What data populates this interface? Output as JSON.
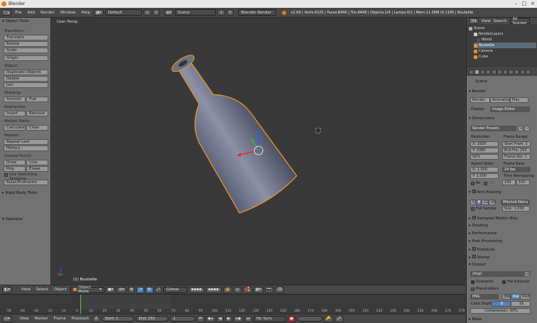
{
  "window": {
    "title": "Blender"
  },
  "topbar": {
    "menus": [
      "File",
      "Add",
      "Render",
      "Window",
      "Help"
    ],
    "layout": "Default",
    "scene": "Scene",
    "engine": "Blender Render",
    "stats": "v2.69 | Verts:4225 | Faces:8440 | Tris:8448 | Objects:1/4 | Lamps:0/2 | Mem:11.00M (0.11M) | Bouteille"
  },
  "toolshelf": {
    "header": "Object Tools",
    "transform_label": "Transform:",
    "translate": "Translate",
    "rotate": "Rotate",
    "scale": "Scale",
    "origin": "Origin",
    "object_label": "Object:",
    "duplicate": "Duplicate Objects",
    "delete": "Delete",
    "join": "Join",
    "shading_label": "Shading:",
    "smooth": "Smooth",
    "flat": "Flat",
    "keyframes_label": "Keyframes:",
    "insert": "Insert",
    "remove": "Remove",
    "motion_label": "Motion Paths:",
    "calculate": "Calculate",
    "clear": "Clear",
    "repeat_label": "Repeat:",
    "repeat_last": "Repeat Last",
    "history": "History...",
    "grease_label": "Grease Pencil:",
    "draw": "Draw",
    "line": "Line",
    "poly": "Poly",
    "erase": "Erase",
    "sketching": "Use Sketching Sessions",
    "ruler": "Ruler/Protractor",
    "rigid": "Rigid Body Tools",
    "operator": "Operator"
  },
  "viewport": {
    "label": "User Persp",
    "object": "(1) Bouteille"
  },
  "vpheader": {
    "menus": [
      "View",
      "Select",
      "Object"
    ],
    "mode": "Object Mode",
    "orientation": "Global"
  },
  "timeline": {
    "ticks": [
      "-50",
      "-40",
      "-30",
      "-20",
      "-10",
      "0",
      "10",
      "20",
      "30",
      "40",
      "50",
      "60",
      "70",
      "80",
      "90",
      "100",
      "110",
      "120",
      "130",
      "140",
      "150",
      "160",
      "170",
      "180",
      "190",
      "200",
      "210",
      "220",
      "230",
      "240",
      "250",
      "260",
      "270",
      "279"
    ],
    "menus": [
      "View",
      "Marker",
      "Frame",
      "Playback"
    ],
    "start": "Start: 1",
    "end": "End: 250",
    "current": "1",
    "sync": "No Sync"
  },
  "outliner": {
    "view": "View",
    "search": "Search",
    "scope": "All Scenes",
    "items": [
      "Scene",
      "RenderLayers",
      "World",
      "Bouteille",
      "Camera",
      "Cube"
    ]
  },
  "props": {
    "scene": "Scene",
    "render_hdr": "Render",
    "render_btn": "Render",
    "anim_btn": "Animation",
    "play_btn": "Play",
    "display_label": "Display:",
    "display_val": "Image Editor",
    "dimensions_hdr": "Dimensions",
    "presets": "Render Presets",
    "resolution": "Resolution:",
    "frame_range": "Frame Range:",
    "resx": "X: 1920",
    "resy": "Y: 1080",
    "respct": "50%",
    "fstart": "Start Fram: 1",
    "fend": "End Fra: 250",
    "fstep": "Frame Ste: 1",
    "aspect": "Aspect Ratio:",
    "framerate": "Frame Rate:",
    "aspx": "X: 1.000",
    "aspy": "Y: 1.000",
    "fps": "24 fps",
    "remap": "Time Remapping:",
    "bo": "Bo",
    "cro": "Cro",
    "r1": "100",
    "r2": "100",
    "aa_hdr": "Anti-Aliasing",
    "aa_samples": [
      "5",
      "8",
      "11",
      "16"
    ],
    "filter": "Mitchell-Netra",
    "fullsample": "Full Sample",
    "size": "Size: 1.000",
    "sections": [
      "Sampled Motion Blur",
      "Shading",
      "Performance",
      "Post Processing",
      "Freestyle",
      "Stamp"
    ],
    "output_hdr": "Output",
    "path": "/tmp\\",
    "overwrite": "Overwrite",
    "fileext": "File Extensio",
    "placeholders": "Placeholders",
    "format": "PNG",
    "bw": "BW",
    "rgb": "RGB",
    "rgba": "RGBA",
    "depth_label": "Color Depth:",
    "d8": "8",
    "d16": "16",
    "compression": "Compression: 90%",
    "bake_hdr": "Bake"
  }
}
